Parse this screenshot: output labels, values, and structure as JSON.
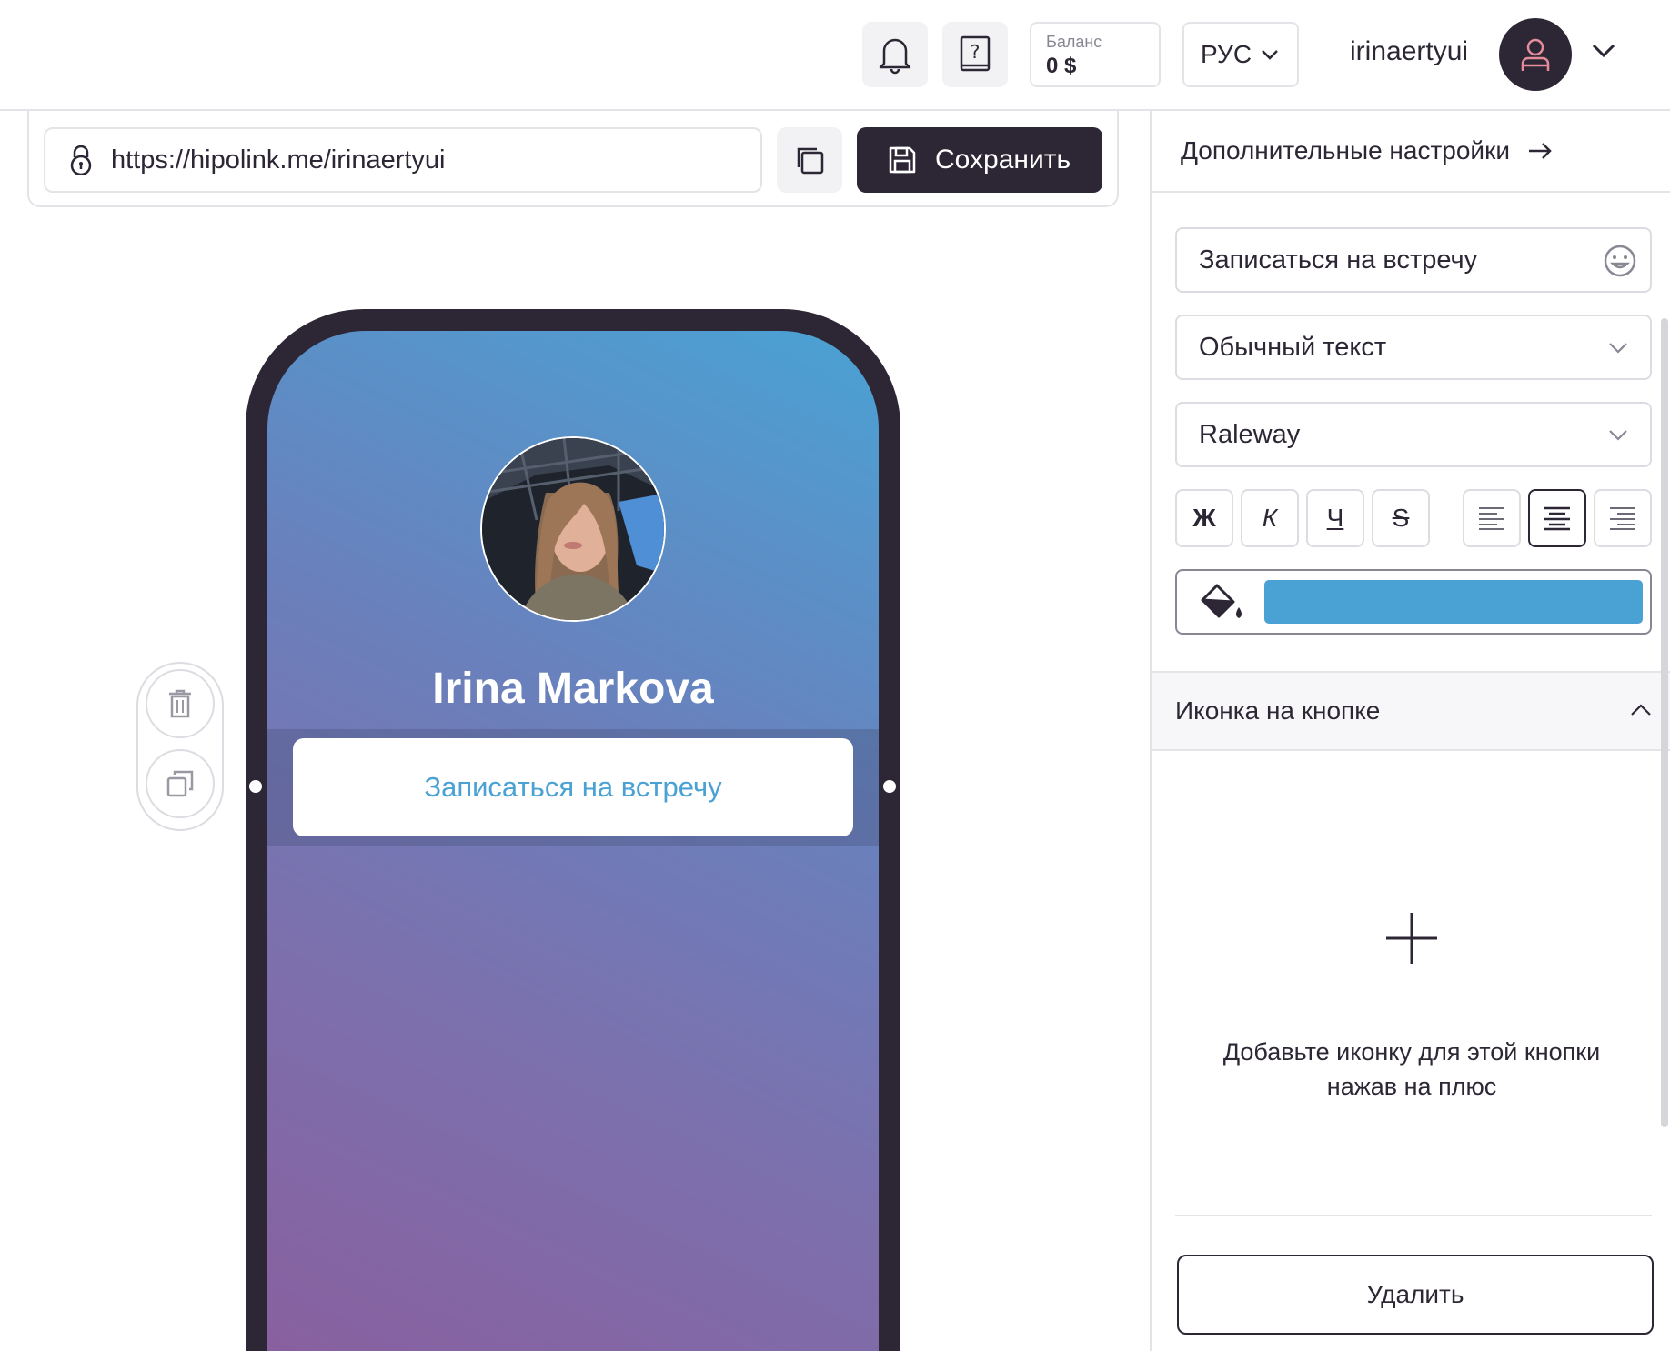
{
  "header": {
    "balance_label": "Баланс",
    "balance_value": "0 $",
    "language": "РУС",
    "username": "irinaertyui"
  },
  "editor": {
    "url": "https://hipolink.me/irinaertyui",
    "save_label": "Сохранить"
  },
  "preview": {
    "profile_name": "Irina Markova",
    "button_label": "Записаться на встречу"
  },
  "panel": {
    "advanced_settings": "Дополнительные настройки",
    "button_text_value": "Записаться на встречу",
    "text_style": "Обычный текст",
    "font": "Raleway",
    "format": {
      "bold": "Ж",
      "italic": "К",
      "underline": "Ч",
      "strike": "S"
    },
    "button_color": "#4aa2d4",
    "icon_section_title": "Иконка на кнопке",
    "icon_hint": "Добавьте иконку для этой кнопки нажав на плюс",
    "delete_label": "Удалить"
  },
  "theme": {
    "dark": "#2d2735",
    "accent": "#4aa2d4",
    "gradient_top": "#4aa2d4",
    "gradient_bottom": "#8a5e9e"
  }
}
